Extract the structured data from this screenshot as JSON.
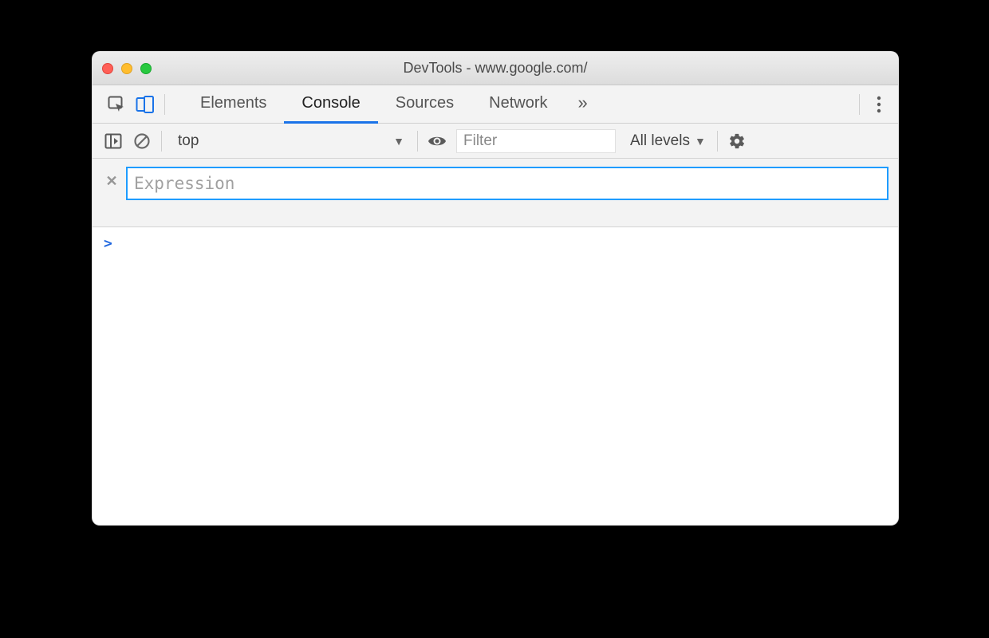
{
  "window": {
    "title": "DevTools - www.google.com/"
  },
  "tabs": {
    "items": [
      "Elements",
      "Console",
      "Sources",
      "Network"
    ],
    "active": "Console"
  },
  "subbar": {
    "context": "top",
    "filter_placeholder": "Filter",
    "levels_label": "All levels"
  },
  "expression": {
    "placeholder": "Expression",
    "value": ""
  },
  "console": {
    "prompt": ">"
  }
}
